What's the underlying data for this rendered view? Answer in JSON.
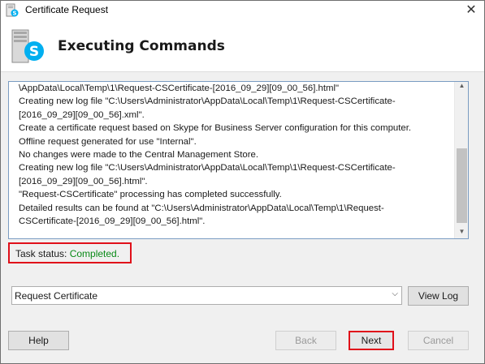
{
  "window": {
    "title": "Certificate Request",
    "close_glyph": "✕"
  },
  "header": {
    "title": "Executing Commands"
  },
  "log": {
    "lines": [
      "\\AppData\\Local\\Temp\\1\\Request-CSCertificate-[2016_09_29][09_00_56].html\"",
      "Creating new log file \"C:\\Users\\Administrator\\AppData\\Local\\Temp\\1\\Request-CSCertificate-",
      "[2016_09_29][09_00_56].xml\".",
      "Create a certificate request based on Skype for Business Server configuration for this computer.",
      "Offline request generated for use \"Internal\".",
      "No changes were made to the Central Management Store.",
      "Creating new log file \"C:\\Users\\Administrator\\AppData\\Local\\Temp\\1\\Request-CSCertificate-",
      "[2016_09_29][09_00_56].html\".",
      "\"Request-CSCertificate\" processing has completed successfully.",
      "Detailed results can be found at \"C:\\Users\\Administrator\\AppData\\Local\\Temp\\1\\Request-",
      "CSCertificate-[2016_09_29][09_00_56].html\"."
    ]
  },
  "status": {
    "label": "Task status: ",
    "value": "Completed."
  },
  "task_select": {
    "selected": "Request Certificate"
  },
  "buttons": {
    "view_log": "View Log",
    "help": "Help",
    "back": "Back",
    "next": "Next",
    "cancel": "Cancel"
  },
  "colors": {
    "highlight": "#e0101a",
    "status_ok": "#0a8a17",
    "skype_blue": "#00aff0"
  },
  "icons": {
    "title": "skype-certificate-icon",
    "header": "skype-server-icon"
  }
}
